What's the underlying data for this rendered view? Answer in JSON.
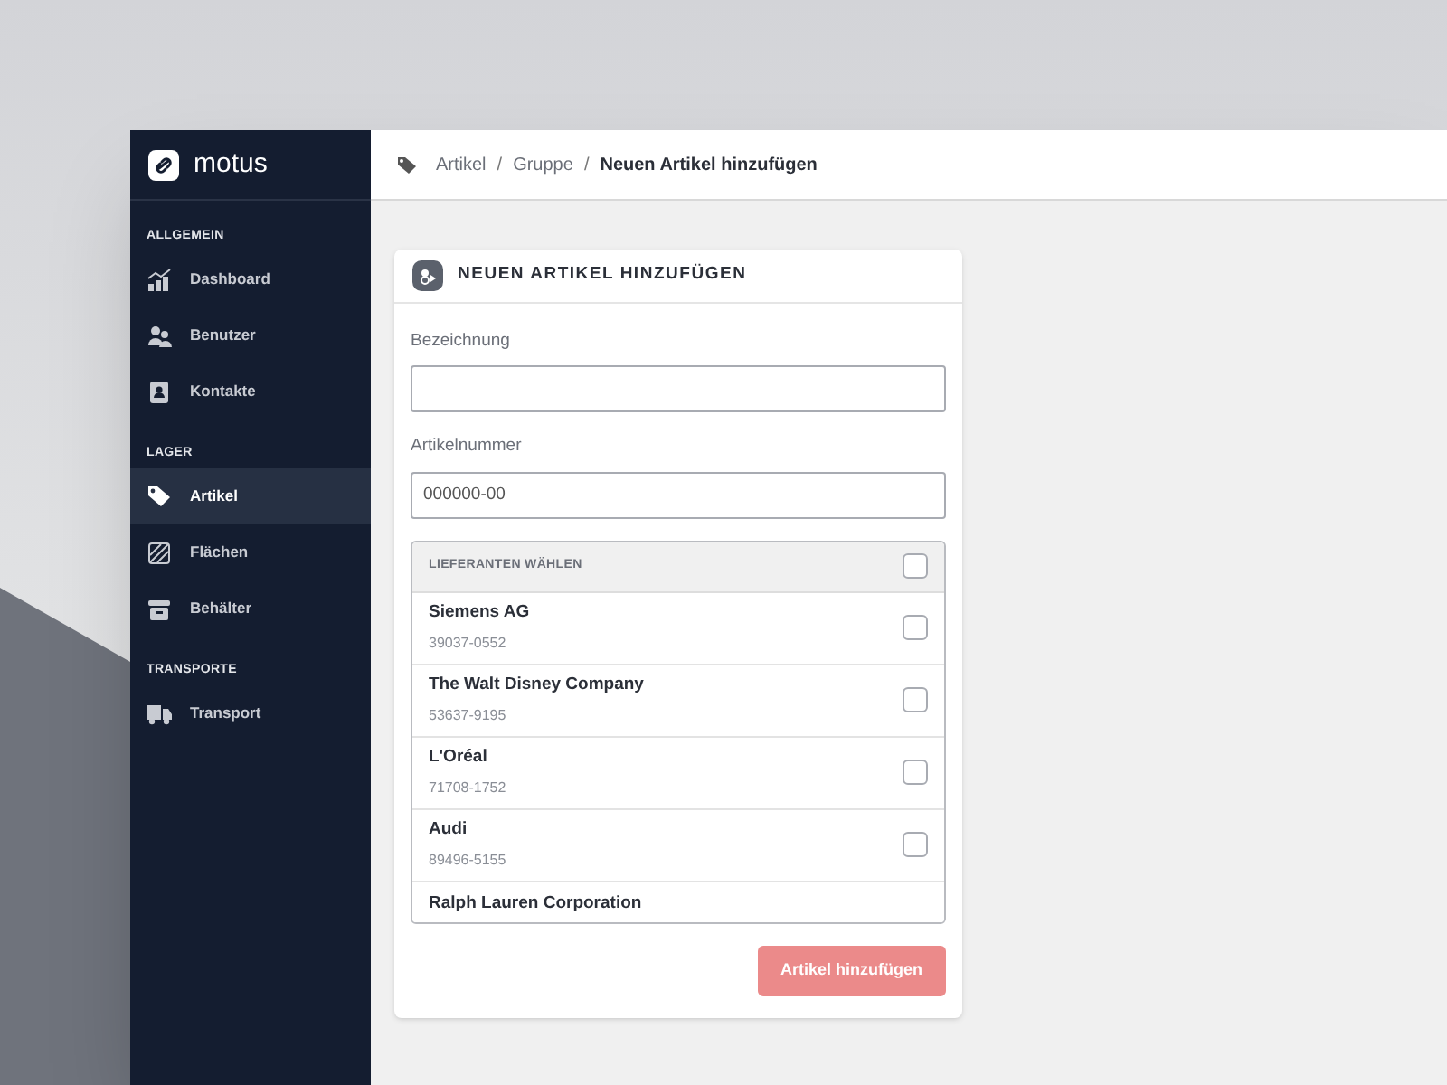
{
  "logo": {
    "text": "motus"
  },
  "sidebar": {
    "sections": [
      {
        "title": "ALLGEMEIN",
        "items": [
          {
            "label": "Dashboard",
            "selected": false
          },
          {
            "label": "Benutzer",
            "selected": false
          },
          {
            "label": "Kontakte",
            "selected": false
          }
        ]
      },
      {
        "title": "LAGER",
        "items": [
          {
            "label": "Artikel",
            "selected": true
          },
          {
            "label": "Flächen",
            "selected": false
          },
          {
            "label": "Behälter",
            "selected": false
          }
        ]
      },
      {
        "title": "TRANSPORTE",
        "items": [
          {
            "label": "Transport",
            "selected": false
          }
        ]
      }
    ]
  },
  "breadcrumb": {
    "items": [
      "Artikel",
      "Gruppe",
      "Neuen Artikel hinzufügen"
    ],
    "separators": [
      "/",
      "/"
    ]
  },
  "card": {
    "title": "NEUEN ARTIKEL HINZUFÜGEN",
    "fields": [
      {
        "label": "Bezeichnung"
      },
      {
        "label": "Artikelnummer",
        "placeholder": "000000-00"
      }
    ],
    "suppliers": {
      "header": "LIEFERANTEN WÄHLEN",
      "all_checked": false,
      "rows": [
        {
          "name": "Siemens AG",
          "number": "39037-0552",
          "checked": false
        },
        {
          "name": "The Walt Disney Company",
          "number": "53637-9195",
          "checked": false
        },
        {
          "name": "L'Oréal",
          "number": "71708-1752",
          "checked": false
        },
        {
          "name": "Audi",
          "number": "89496-5155",
          "checked": false
        },
        {
          "name": "Ralph Lauren Corporation"
        }
      ]
    },
    "button": {
      "label": "Artikel hinzufügen",
      "disabled": true
    }
  }
}
